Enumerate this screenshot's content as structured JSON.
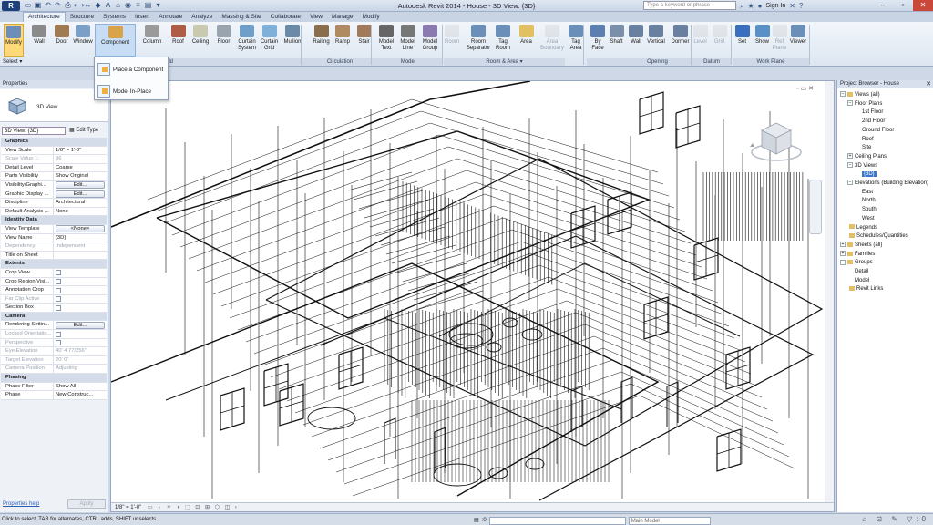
{
  "window": {
    "title": "Autodesk Revit 2014 -   House - 3D View: {3D}",
    "search_placeholder": "Type a keyword or phrase",
    "sign_in": "Sign In",
    "logo": "R"
  },
  "tabs": [
    "Architecture",
    "Structure",
    "Systems",
    "Insert",
    "Annotate",
    "Analyze",
    "Massing & Site",
    "Collaborate",
    "View",
    "Manage",
    "Modify"
  ],
  "ribbon": {
    "select_label": "Select ▾",
    "tools": [
      {
        "label": "Modify"
      },
      {
        "label": "Wall"
      },
      {
        "label": "Door"
      },
      {
        "label": "Window"
      },
      {
        "label": "Component"
      },
      {
        "label": "Column"
      },
      {
        "label": "Roof"
      },
      {
        "label": "Ceiling"
      },
      {
        "label": "Floor"
      },
      {
        "label": "Curtain\nSystem"
      },
      {
        "label": "Curtain\nGrid"
      },
      {
        "label": "Mullion"
      },
      {
        "label": "Railing"
      },
      {
        "label": "Ramp"
      },
      {
        "label": "Stair"
      },
      {
        "label": "Model\nText"
      },
      {
        "label": "Model\nLine"
      },
      {
        "label": "Model\nGroup"
      },
      {
        "label": "Room"
      },
      {
        "label": "Room\nSeparator"
      },
      {
        "label": "Tag\nRoom"
      },
      {
        "label": "Area"
      },
      {
        "label": "Area\nBoundary"
      },
      {
        "label": "Tag\nArea"
      },
      {
        "label": "By\nFace"
      },
      {
        "label": "Shaft"
      },
      {
        "label": "Wall"
      },
      {
        "label": "Vertical"
      },
      {
        "label": "Dormer"
      },
      {
        "label": "Level"
      },
      {
        "label": "Grid"
      },
      {
        "label": "Set"
      },
      {
        "label": "Show"
      },
      {
        "label": "Ref\nPlane"
      },
      {
        "label": "Viewer"
      }
    ],
    "panels": [
      "Circulation",
      "Model",
      "Room & Area ▾",
      "Opening",
      "Datum",
      "Work Plane"
    ],
    "partial_panel_label": "ld"
  },
  "dropdown": {
    "items": [
      "Place a Component",
      "Model In-Place"
    ]
  },
  "properties": {
    "title": "Properties",
    "type_name": "3D View",
    "view_selector": "3D View: {3D}",
    "edit_type": "Edit Type",
    "rows": [
      {
        "k": "Graphics",
        "group": true
      },
      {
        "k": "View Scale",
        "v": "1/8\" = 1'-0\""
      },
      {
        "k": "Scale Value    1:",
        "v": "96",
        "dis": true
      },
      {
        "k": "Detail Level",
        "v": "Coarse"
      },
      {
        "k": "Parts Visibility",
        "v": "Show Original"
      },
      {
        "k": "Visibility/Graphi...",
        "v": "Edit...",
        "btn": true
      },
      {
        "k": "Graphic Display ...",
        "v": "Edit...",
        "btn": true
      },
      {
        "k": "Discipline",
        "v": "Architectural"
      },
      {
        "k": "Default Analysis ...",
        "v": "None"
      },
      {
        "k": "Identity Data",
        "group": true
      },
      {
        "k": "View Template",
        "v": "<None>",
        "btn": true
      },
      {
        "k": "View Name",
        "v": "{3D}"
      },
      {
        "k": "Dependency",
        "v": "Independent",
        "dis": true
      },
      {
        "k": "Title on Sheet",
        "v": ""
      },
      {
        "k": "Extents",
        "group": true
      },
      {
        "k": "Crop View",
        "cb": true
      },
      {
        "k": "Crop Region Visi...",
        "cb": true
      },
      {
        "k": "Annotation Crop",
        "cb": true
      },
      {
        "k": "Far Clip Active",
        "cb": true,
        "dis": true
      },
      {
        "k": "Section Box",
        "cb": true
      },
      {
        "k": "Camera",
        "group": true
      },
      {
        "k": "Rendering Settin...",
        "v": "Edit...",
        "btn": true
      },
      {
        "k": "Locked Orientatio...",
        "cb": true,
        "dis": true
      },
      {
        "k": "Perspective",
        "cb": true,
        "dis": true
      },
      {
        "k": "Eye Elevation",
        "v": "40' 4 77/256\"",
        "dis": true
      },
      {
        "k": "Target Elevation",
        "v": "20' 0\"",
        "dis": true
      },
      {
        "k": "Camera Position",
        "v": "Adjusting",
        "dis": true
      },
      {
        "k": "Phasing",
        "group": true
      },
      {
        "k": "Phase Filter",
        "v": "Show All"
      },
      {
        "k": "Phase",
        "v": "New Construc..."
      }
    ],
    "help_link": "Properties help",
    "apply": "Apply"
  },
  "viewport": {
    "scale": "1/8\" = 1'-0\""
  },
  "browser": {
    "title": "Project Browser - House",
    "nodes": [
      {
        "label": "Views (all)",
        "level": 0,
        "toggle": "−",
        "box": true
      },
      {
        "label": "Floor Plans",
        "level": 1,
        "toggle": "−"
      },
      {
        "label": "1st Floor",
        "level": 3
      },
      {
        "label": "2nd Floor",
        "level": 3
      },
      {
        "label": "Ground Floor",
        "level": 3
      },
      {
        "label": "Roof",
        "level": 3
      },
      {
        "label": "Site",
        "level": 3
      },
      {
        "label": "Ceiling Plans",
        "level": 1,
        "toggle": "+"
      },
      {
        "label": "3D Views",
        "level": 1,
        "toggle": "−"
      },
      {
        "label": "{3D}",
        "level": 3,
        "sel": true
      },
      {
        "label": "Elevations (Building Elevation)",
        "level": 1,
        "toggle": "−"
      },
      {
        "label": "East",
        "level": 3
      },
      {
        "label": "North",
        "level": 3
      },
      {
        "label": "South",
        "level": 3
      },
      {
        "label": "West",
        "level": 3
      },
      {
        "label": "Legends",
        "level": 0,
        "box": true
      },
      {
        "label": "Schedules/Quantities",
        "level": 0,
        "box": true
      },
      {
        "label": "Sheets (all)",
        "level": 0,
        "toggle": "+",
        "box": true
      },
      {
        "label": "Families",
        "level": 0,
        "toggle": "+",
        "box": true
      },
      {
        "label": "Groups",
        "level": 0,
        "toggle": "−",
        "box": true
      },
      {
        "label": "Detail",
        "level": 2
      },
      {
        "label": "Model",
        "level": 2
      },
      {
        "label": "Revit Links",
        "level": 0,
        "link": true
      }
    ]
  },
  "status": {
    "text": "Click to select, TAB for alternates, CTRL adds, SHIFT unselects.",
    "coord": ":0",
    "model": "Main Model"
  }
}
